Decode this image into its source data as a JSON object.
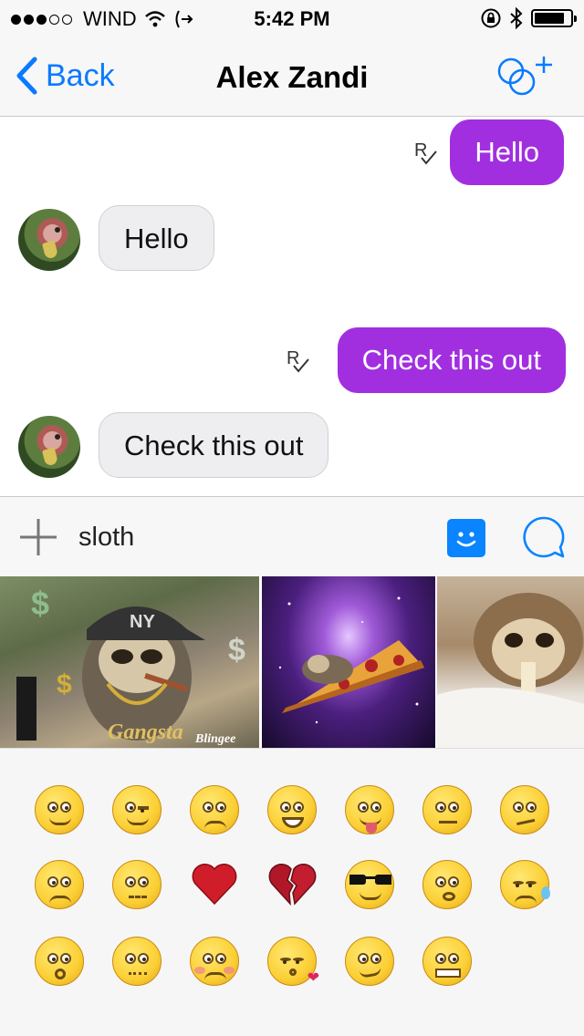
{
  "status_bar": {
    "carrier": "WIND",
    "time": "5:42 PM",
    "signal_bars_filled": 3,
    "signal_bars_total": 5,
    "battery_level": 0.85
  },
  "nav": {
    "back_label": "Back",
    "title": "Alex Zandi",
    "accent_color": "#0a7aff"
  },
  "messages": [
    {
      "direction": "outgoing",
      "text": "Hello"
    },
    {
      "direction": "incoming",
      "text": "Hello"
    },
    {
      "direction": "outgoing",
      "text": "Check this out"
    },
    {
      "direction": "incoming",
      "text": "Check this out"
    }
  ],
  "receipt_glyph": "R",
  "outgoing_bubble_color": "#a12fe0",
  "input": {
    "value": "sloth"
  },
  "gifs": [
    {
      "name": "sloth-gangsta-gif",
      "caption": "Gangsta",
      "watermark": "Blingee"
    },
    {
      "name": "sloth-pizza-space-gif"
    },
    {
      "name": "sloth-eating-gif"
    }
  ],
  "emojis": [
    "smile-emoji",
    "wink-emoji",
    "worried-emoji",
    "grin-emoji",
    "tongue-emoji",
    "neutral-emoji",
    "confused-emoji",
    "angry-emoji",
    "zipper-mouth-emoji",
    "red-heart-icon",
    "broken-heart-icon",
    "sunglasses-emoji",
    "pouting-emoji",
    "sad-sweat-emoji",
    "astonished-emoji",
    "wavy-mouth-emoji",
    "blush-emoji",
    "kiss-emoji",
    "smirk-emoji",
    "grimace-emoji"
  ]
}
